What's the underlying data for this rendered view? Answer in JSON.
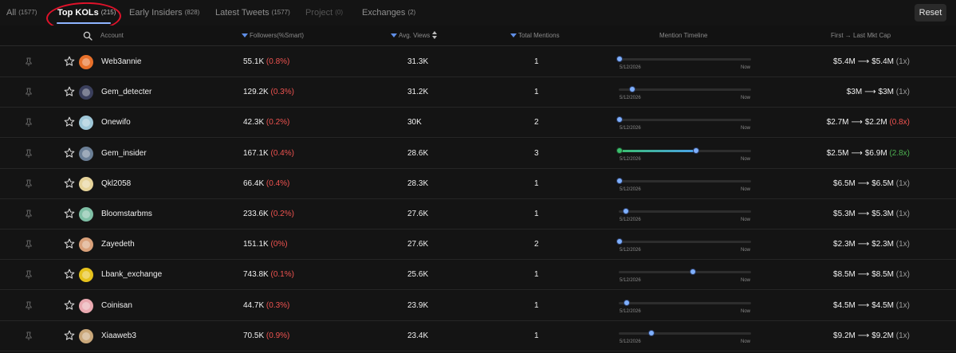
{
  "tabs": [
    {
      "label": "All",
      "count": "(1577)",
      "state": "normal"
    },
    {
      "label": "Top KOLs",
      "count": "(215)",
      "state": "active"
    },
    {
      "label": "Early Insiders",
      "count": "(828)",
      "state": "normal"
    },
    {
      "label": "Latest Tweets",
      "count": "(1577)",
      "state": "normal"
    },
    {
      "label": "Project",
      "count": "(0)",
      "state": "disabled"
    },
    {
      "label": "Exchanges",
      "count": "(2)",
      "state": "normal"
    }
  ],
  "reset_label": "Reset",
  "headers": {
    "account": "Account",
    "followers": "Followers(%Smart)",
    "avg_views": "Avg. Views",
    "total_mentions": "Total Mentions",
    "timeline": "Mention Timeline",
    "mktcap": "First → Last Mkt Cap"
  },
  "timeline_start": "5/12/2026",
  "timeline_end": "Now",
  "colors": {
    "accent": "#8fb4ff",
    "negative": "#ef5350",
    "positive": "#4caf50",
    "annotation": "#e0122a"
  },
  "rows": [
    {
      "name": "Web3annie",
      "followers": "55.1K",
      "smart": "(0.8%)",
      "views": "31.3K",
      "mentions": "1",
      "first": "$5.4M",
      "last": "$5.4M",
      "mult": "(1x)",
      "mult_tone": "gray",
      "timeline_pos": 0.0,
      "avatar": "#e8702a"
    },
    {
      "name": "Gem_detecter",
      "followers": "129.2K",
      "smart": "(0.3%)",
      "views": "31.2K",
      "mentions": "1",
      "first": "$3M",
      "last": "$3M",
      "mult": "(1x)",
      "mult_tone": "gray",
      "timeline_pos": 0.1,
      "avatar": "#3a3f5c"
    },
    {
      "name": "Onewifo",
      "followers": "42.3K",
      "smart": "(0.2%)",
      "views": "30K",
      "mentions": "2",
      "first": "$2.7M",
      "last": "$2.2M",
      "mult": "(0.8x)",
      "mult_tone": "red",
      "timeline_pos": 0.0,
      "avatar": "#9fc7d8"
    },
    {
      "name": "Gem_insider",
      "followers": "167.1K",
      "smart": "(0.4%)",
      "views": "28.6K",
      "mentions": "3",
      "first": "$2.5M",
      "last": "$6.9M",
      "mult": "(2.8x)",
      "mult_tone": "green",
      "timeline_pos": 0.61,
      "avatar": "#6b7f96"
    },
    {
      "name": "Qkl2058",
      "followers": "66.4K",
      "smart": "(0.4%)",
      "views": "28.3K",
      "mentions": "1",
      "first": "$6.5M",
      "last": "$6.5M",
      "mult": "(1x)",
      "mult_tone": "gray",
      "timeline_pos": 0.0,
      "avatar": "#e6d39a"
    },
    {
      "name": "Bloomstarbms",
      "followers": "233.6K",
      "smart": "(0.2%)",
      "views": "27.6K",
      "mentions": "1",
      "first": "$5.3M",
      "last": "$5.3M",
      "mult": "(1x)",
      "mult_tone": "gray",
      "timeline_pos": 0.05,
      "avatar": "#7fbfa5"
    },
    {
      "name": "Zayedeth",
      "followers": "151.1K",
      "smart": "(0%)",
      "views": "27.6K",
      "mentions": "2",
      "first": "$2.3M",
      "last": "$2.3M",
      "mult": "(1x)",
      "mult_tone": "gray",
      "timeline_pos": 0.0,
      "avatar": "#d9a17a"
    },
    {
      "name": "Lbank_exchange",
      "followers": "743.8K",
      "smart": "(0.1%)",
      "views": "25.6K",
      "mentions": "1",
      "first": "$8.5M",
      "last": "$8.5M",
      "mult": "(1x)",
      "mult_tone": "gray",
      "timeline_pos": 0.58,
      "avatar": "#e6c21d"
    },
    {
      "name": "Coinisan",
      "followers": "44.7K",
      "smart": "(0.3%)",
      "views": "23.9K",
      "mentions": "1",
      "first": "$4.5M",
      "last": "$4.5M",
      "mult": "(1x)",
      "mult_tone": "gray",
      "timeline_pos": 0.06,
      "avatar": "#e9a9b0"
    },
    {
      "name": "Xiaaweb3",
      "followers": "70.5K",
      "smart": "(0.9%)",
      "views": "23.4K",
      "mentions": "1",
      "first": "$9.2M",
      "last": "$9.2M",
      "mult": "(1x)",
      "mult_tone": "gray",
      "timeline_pos": 0.25,
      "avatar": "#c9a77a"
    }
  ]
}
